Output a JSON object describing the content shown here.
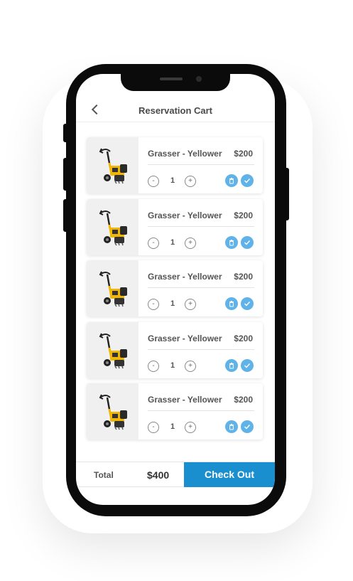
{
  "header": {
    "title": "Reservation Cart",
    "back_icon": "chevron-left-icon"
  },
  "cart": {
    "items": [
      {
        "name": "Grasser - Yellower",
        "price": "$200",
        "quantity": "1",
        "minus": "-",
        "plus": "+"
      },
      {
        "name": "Grasser - Yellower",
        "price": "$200",
        "quantity": "1",
        "minus": "-",
        "plus": "+"
      },
      {
        "name": "Grasser - Yellower",
        "price": "$200",
        "quantity": "1",
        "minus": "-",
        "plus": "+"
      },
      {
        "name": "Grasser - Yellower",
        "price": "$200",
        "quantity": "1",
        "minus": "-",
        "plus": "+"
      },
      {
        "name": "Grasser - Yellower",
        "price": "$200",
        "quantity": "1",
        "minus": "-",
        "plus": "+"
      }
    ],
    "item_icons": [
      "trash-icon",
      "check-icon"
    ]
  },
  "footer": {
    "total_label": "Total",
    "total_value": "$400",
    "checkout_label": "Check Out"
  },
  "colors": {
    "accent": "#1a8fd0",
    "action_icon_bg": "#5fb3e8",
    "product_yellow": "#f2b705"
  }
}
